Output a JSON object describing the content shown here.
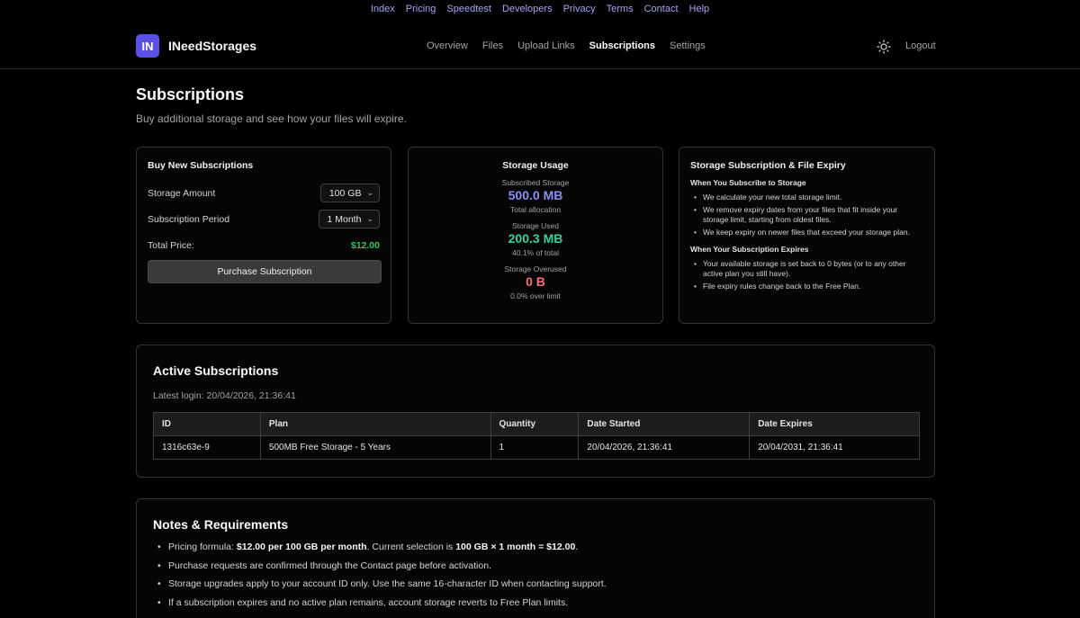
{
  "top_links": [
    "Index",
    "Pricing",
    "Speedtest",
    "Developers",
    "Privacy",
    "Terms",
    "Contact",
    "Help"
  ],
  "brand": {
    "logo": "IN",
    "name": "INeedStorages"
  },
  "nav": {
    "items": [
      "Overview",
      "Files",
      "Upload Links",
      "Subscriptions",
      "Settings"
    ],
    "active": "Subscriptions"
  },
  "header": {
    "theme_icon": "sun-icon",
    "logout": "Logout"
  },
  "page": {
    "title": "Subscriptions",
    "subtitle": "Buy additional storage and see how your files will expire."
  },
  "buy": {
    "title": "Buy New Subscriptions",
    "storage_label": "Storage Amount",
    "storage_value": "100 GB",
    "period_label": "Subscription Period",
    "period_value": "1 Month",
    "price_label": "Total Price:",
    "price_value": "$12.00",
    "button": "Purchase Subscription"
  },
  "usage": {
    "title": "Storage Usage",
    "subscribed_label": "Subscribed Storage",
    "subscribed_value": "500.0 MB",
    "subscribed_sub": "Total allocation",
    "used_label": "Storage Used",
    "used_value": "200.3 MB",
    "used_sub": "40.1% of total",
    "overused_label": "Storage Overused",
    "overused_value": "0 B",
    "overused_sub": "0.0% over limit"
  },
  "expiry": {
    "title": "Storage Subscription & File Expiry",
    "subscribe_heading": "When You Subscribe to Storage",
    "subscribe_items": [
      "We calculate your new total storage limit.",
      "We remove expiry dates from your files that fit inside your storage limit, starting from oldest files.",
      "We keep expiry on newer files that exceed your storage plan."
    ],
    "expires_heading": "When Your Subscription Expires",
    "expires_items": [
      "Your available storage is set back to 0 bytes (or to any other active plan you still have).",
      "File expiry rules change back to the Free Plan."
    ]
  },
  "active": {
    "title": "Active Subscriptions",
    "latest_login": "Latest login: 20/04/2026, 21:36:41",
    "columns": [
      "ID",
      "Plan",
      "Quantity",
      "Date Started",
      "Date Expires"
    ],
    "rows": [
      [
        "1316c63e-9",
        "500MB Free Storage - 5 Years",
        "1",
        "20/04/2026, 21:36:41",
        "20/04/2031, 21:36:41"
      ]
    ]
  },
  "notes": {
    "title": "Notes & Requirements",
    "formula_prefix": "Pricing formula: ",
    "formula_bold": "$12.00 per 100 GB per month",
    "formula_mid": ". Current selection is ",
    "formula_bold2": "100 GB × 1 month = $12.00",
    "formula_end": ".",
    "items": [
      "Purchase requests are confirmed through the Contact page before activation.",
      "Storage upgrades apply to your account ID only. Use the same 16-character ID when contacting support.",
      "If a subscription expires and no active plan remains, account storage reverts to Free Plan limits."
    ]
  },
  "colors": {
    "accent": "#5b50e6",
    "subscribed": "#8b8ef8",
    "used": "#34d399",
    "overused": "#f87171",
    "price": "#22c55e",
    "top_links": "#a5a3f5"
  }
}
